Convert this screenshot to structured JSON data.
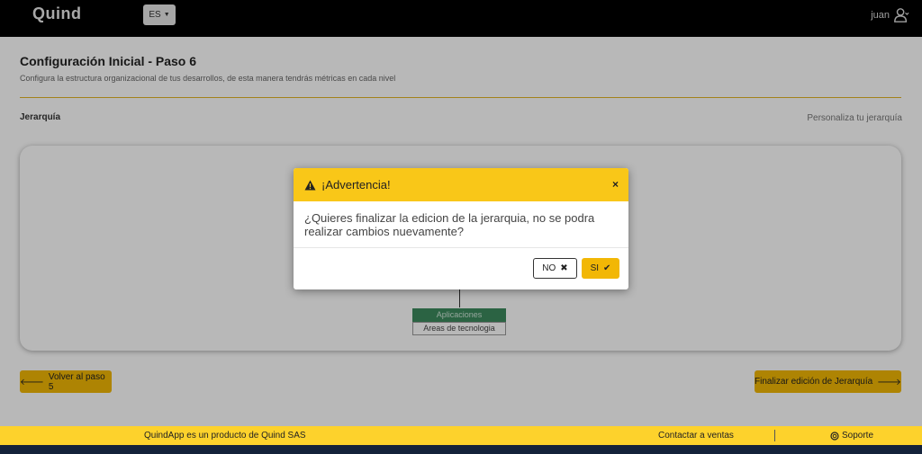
{
  "navbar": {
    "logo_text": "Quind",
    "lang_label": "ES",
    "user_name": "juan"
  },
  "page": {
    "title": "Configuración Inicial - Paso 6",
    "subtitle": "Configura la estructura organizacional de tus desarrollos, de esta manera tendrás métricas en cada nivel",
    "section_label": "Jerarquía",
    "section_right": "Personaliza tu jerarquía"
  },
  "tree": {
    "node_name": "Aplicaciones",
    "node_type": "Areas de tecnologia"
  },
  "actions": {
    "back_label": "Volver al paso 5",
    "finish_label": "Finalizar edición de Jerarquía"
  },
  "footer": {
    "product_text": "QuindApp es un producto de Quind SAS",
    "contact_text": "Contactar a ventas",
    "support_text": "Soporte"
  },
  "modal": {
    "title": "¡Advertencia!",
    "close_label": "×",
    "message": "¿Quieres finalizar la edicion de la jerarquia, no se podra realizar cambios nuevamente?",
    "no_label": "NO",
    "si_label": "SI"
  },
  "colors": {
    "accent": "#f2b705",
    "modal_header": "#f9c718",
    "footer": "#fdd22c",
    "node_green": "#3c8a5e",
    "navbar": "#000000"
  },
  "icons": {
    "warning": "warning-icon",
    "close": "close-icon",
    "user": "user-icon",
    "back": "arrow-left-icon",
    "forward": "arrow-right-icon",
    "no": "x-icon",
    "si": "check-icon",
    "support": "lifebuoy-icon"
  }
}
